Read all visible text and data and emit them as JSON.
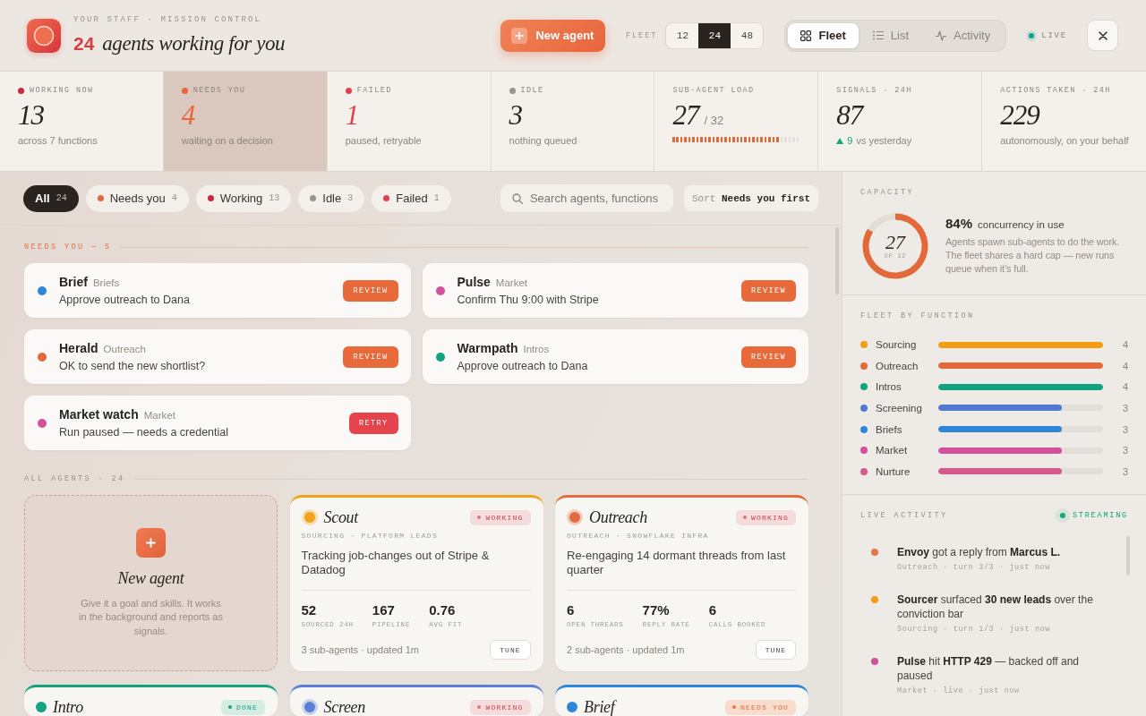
{
  "header": {
    "eyebrow": "YOUR STAFF · MISSION CONTROL",
    "count": "24",
    "title": "agents working for you",
    "new_button": "New agent",
    "fleet_label": "FLEET",
    "fleet_sizes": [
      {
        "label": "12",
        "selected": false
      },
      {
        "label": "24",
        "selected": true
      },
      {
        "label": "48",
        "selected": false
      }
    ],
    "views": [
      {
        "kind": "grid",
        "label": "Fleet",
        "selected": true
      },
      {
        "kind": "list",
        "label": "List",
        "selected": false
      },
      {
        "kind": "pulse",
        "label": "Activity",
        "selected": false
      }
    ],
    "live": "LIVE"
  },
  "stats": [
    {
      "kind": "count",
      "label": "WORKING NOW",
      "color": "#c8283f",
      "emphasis": false,
      "value": "13",
      "note": "across 7 functions",
      "selected": false
    },
    {
      "kind": "count",
      "label": "NEEDS YOU",
      "color": "#e8673a",
      "emphasis": true,
      "value": "4",
      "note": "waiting on a decision",
      "selected": true
    },
    {
      "kind": "count",
      "label": "FAILED",
      "color": "#e0414e",
      "emphasis": true,
      "value": "1",
      "note": "paused, retryable",
      "selected": false
    },
    {
      "kind": "count",
      "label": "IDLE",
      "color": "#9c9288",
      "emphasis": false,
      "value": "3",
      "note": "nothing queued",
      "selected": false
    },
    {
      "kind": "load",
      "label": "SUB-AGENT LOAD",
      "value": "27",
      "total": "/ 32",
      "level": 0.84,
      "selected": false
    },
    {
      "kind": "delta",
      "label": "SIGNALS · 24H",
      "value": "87",
      "delta": "9",
      "note": "vs yesterday",
      "selected": false
    },
    {
      "kind": "plain",
      "label": "ACTIONS TAKEN · 24H",
      "value": "229",
      "note": "autonomously, on your behalf",
      "selected": false
    }
  ],
  "filters": [
    {
      "label": "All",
      "count": "24",
      "selected": true
    },
    {
      "label": "Needs you",
      "count": "4",
      "color": "#e8673a",
      "selected": false
    },
    {
      "label": "Working",
      "count": "13",
      "color": "#c8283f",
      "selected": false
    },
    {
      "label": "Idle",
      "count": "3",
      "color": "#9c9288",
      "selected": false
    },
    {
      "label": "Failed",
      "count": "1",
      "color": "#e0414e",
      "selected": false
    }
  ],
  "search": {
    "placeholder": "Search agents, functions"
  },
  "sort": {
    "label": "Sort",
    "value": "Needs you first"
  },
  "needs_you": {
    "title": "NEEDS YOU — 5",
    "items": [
      {
        "name": "Brief",
        "function": "Briefs",
        "message": "Approve outreach to Dana",
        "color": "#2d86d8",
        "action": {
          "kind": "review",
          "label": "REVIEW"
        }
      },
      {
        "name": "Pulse",
        "function": "Market",
        "message": "Confirm Thu 9:00 with Stripe",
        "color": "#d4509c",
        "action": {
          "kind": "review",
          "label": "REVIEW"
        }
      },
      {
        "name": "Herald",
        "function": "Outreach",
        "message": "OK to send the new shortlist?",
        "color": "#e4693a",
        "action": {
          "kind": "review",
          "label": "REVIEW"
        }
      },
      {
        "name": "Warmpath",
        "function": "Intros",
        "message": "Approve outreach to Dana",
        "color": "#0fa37f",
        "action": {
          "kind": "review",
          "label": "REVIEW"
        }
      },
      {
        "name": "Market watch",
        "function": "Market",
        "message": "Run paused — needs a credential",
        "color": "#d4509c",
        "action": {
          "kind": "retry",
          "label": "RETRY"
        }
      }
    ]
  },
  "all_agents": {
    "title": "ALL AGENTS · 24",
    "new_card": {
      "title": "New agent",
      "text": "Give it a goal and skills. It works in the background and reports as signals."
    },
    "items": [
      {
        "name": "Scout",
        "color": "#f0a21a",
        "status": {
          "kind": "working",
          "label": "WORKING"
        },
        "meta": "SOURCING · PLATFORM LEADS",
        "summary": "Tracking job-changes out of Stripe & Datadog",
        "metrics": [
          {
            "value": "52",
            "label": "SOURCED 24H"
          },
          {
            "value": "167",
            "label": "PIPELINE"
          },
          {
            "value": "0.76",
            "label": "AVG FIT"
          }
        ],
        "footer": "3 sub-agents · updated 1m",
        "action": "TUNE"
      },
      {
        "name": "Outreach",
        "color": "#e26b3f",
        "status": {
          "kind": "working",
          "label": "WORKING"
        },
        "meta": "OUTREACH · SNOWFLAKE INFRA",
        "summary": "Re-engaging 14 dormant threads from last quarter",
        "metrics": [
          {
            "value": "6",
            "label": "OPEN THREADS"
          },
          {
            "value": "77%",
            "label": "REPLY RATE"
          },
          {
            "value": "6",
            "label": "CALLS BOOKED"
          }
        ],
        "footer": "2 sub-agents · updated 1m",
        "action": "TUNE"
      },
      {
        "name": "Intro",
        "color": "#14a37f",
        "status": {
          "kind": "done",
          "label": "DONE"
        }
      },
      {
        "name": "Screen",
        "color": "#5b7fd4",
        "status": {
          "kind": "working",
          "label": "WORKING"
        }
      },
      {
        "name": "Brief",
        "color": "#2d86d8",
        "status": {
          "kind": "needs",
          "label": "NEEDS YOU"
        }
      }
    ]
  },
  "capacity": {
    "title": "CAPACITY",
    "value": "27",
    "total": "OF 32",
    "chart_data": {
      "type": "donut",
      "values": [
        84,
        16
      ]
    },
    "percent": "84%",
    "headline": "concurrency in use",
    "text": "Agents spawn sub-agents to do the work. The fleet shares a hard cap — new runs queue when it’s full."
  },
  "fleet_by_function": {
    "title": "FLEET BY FUNCTION",
    "rows": [
      {
        "name": "Sourcing",
        "color": "#f29d13",
        "level": 1,
        "count": "4"
      },
      {
        "name": "Outreach",
        "color": "#e4693a",
        "level": 1,
        "count": "4"
      },
      {
        "name": "Intros",
        "color": "#0fa37f",
        "level": 1,
        "count": "4"
      },
      {
        "name": "Screening",
        "color": "#5178d3",
        "level": 0.75,
        "count": "3"
      },
      {
        "name": "Briefs",
        "color": "#2d86d8",
        "level": 0.75,
        "count": "3"
      },
      {
        "name": "Market",
        "color": "#d4509c",
        "level": 0.75,
        "count": "3"
      },
      {
        "name": "Nurture",
        "color": "#d65a8e",
        "level": 0.75,
        "count": "3"
      }
    ]
  },
  "live_activity": {
    "title": "LIVE ACTIVITY",
    "status": "STREAMING",
    "items": [
      {
        "text": "**Envoy** got a reply from **Marcus L.**",
        "meta": "Outreach · turn 3/3 · just now",
        "color": "#e4774a"
      },
      {
        "text": "**Sourcer** surfaced **30 new leads** over the conviction bar",
        "meta": "Sourcing · turn 1/3 · just now",
        "color": "#f29d13"
      },
      {
        "text": "**Pulse** hit **HTTP 429** — backed off and paused",
        "meta": "Market · live · just now",
        "color": "#d4509c"
      }
    ]
  }
}
